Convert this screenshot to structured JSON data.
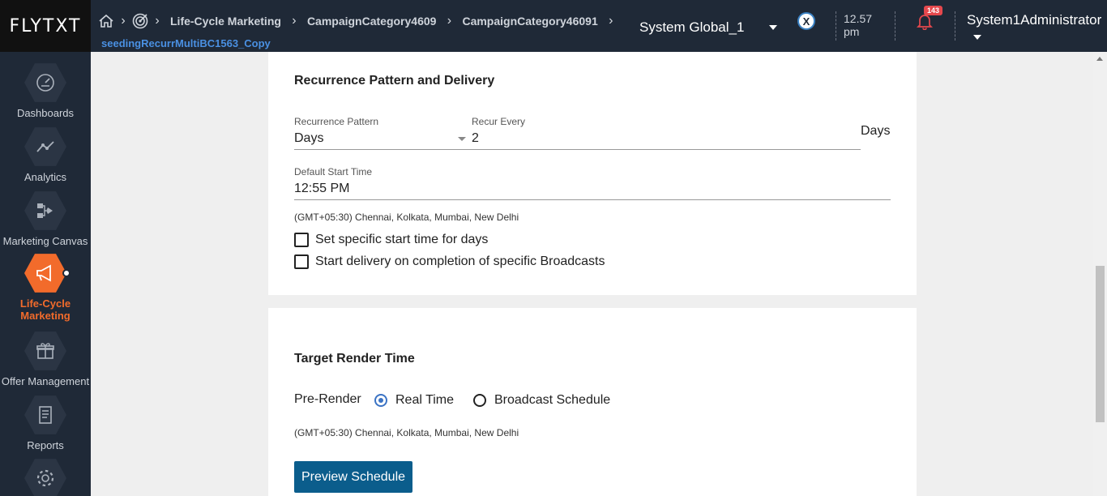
{
  "app": {
    "logo": "FLYTXT"
  },
  "breadcrumb": {
    "items": [
      "Life-Cycle Marketing",
      "CampaignCategory4609",
      "CampaignCategory46091"
    ],
    "sub": "seedingRecurrMultiBC1563_Copy"
  },
  "header": {
    "system": "System Global_1",
    "x_badge": "X",
    "time": "12.57",
    "time_period": "pm",
    "notifications": "143",
    "user": "System1Administrator"
  },
  "sidebar": {
    "items": [
      {
        "label": "Dashboards",
        "icon": "gauge-icon"
      },
      {
        "label": "Analytics",
        "icon": "analytics-icon"
      },
      {
        "label": "Marketing Canvas",
        "icon": "canvas-icon"
      },
      {
        "label": "Life-Cycle Marketing",
        "icon": "megaphone-icon",
        "active": true
      },
      {
        "label": "Offer Management",
        "icon": "gift-icon"
      },
      {
        "label": "Reports",
        "icon": "report-icon"
      },
      {
        "label": "",
        "icon": "gear-icon"
      }
    ]
  },
  "recurrence": {
    "title": "Recurrence Pattern and Delivery",
    "pattern_label": "Recurrence Pattern",
    "pattern_value": "Days",
    "recur_label": "Recur Every",
    "recur_value": "2",
    "recur_unit": "Days",
    "start_label": "Default Start Time",
    "start_value": "12:55 PM",
    "timezone": "(GMT+05:30) Chennai, Kolkata, Mumbai, New Delhi",
    "check1": "Set specific start time for days",
    "check2": "Start delivery on completion of specific Broadcasts"
  },
  "render": {
    "title": "Target Render Time",
    "prerender_label": "Pre-Render",
    "option1": "Real Time",
    "option2": "Broadcast Schedule",
    "timezone": "(GMT+05:30) Chennai, Kolkata, Mumbai, New Delhi",
    "preview_button": "Preview Schedule"
  },
  "colors": {
    "accent": "#f26b2b",
    "sidebar": "#1f2937",
    "primary_button": "#0b5d8c"
  }
}
